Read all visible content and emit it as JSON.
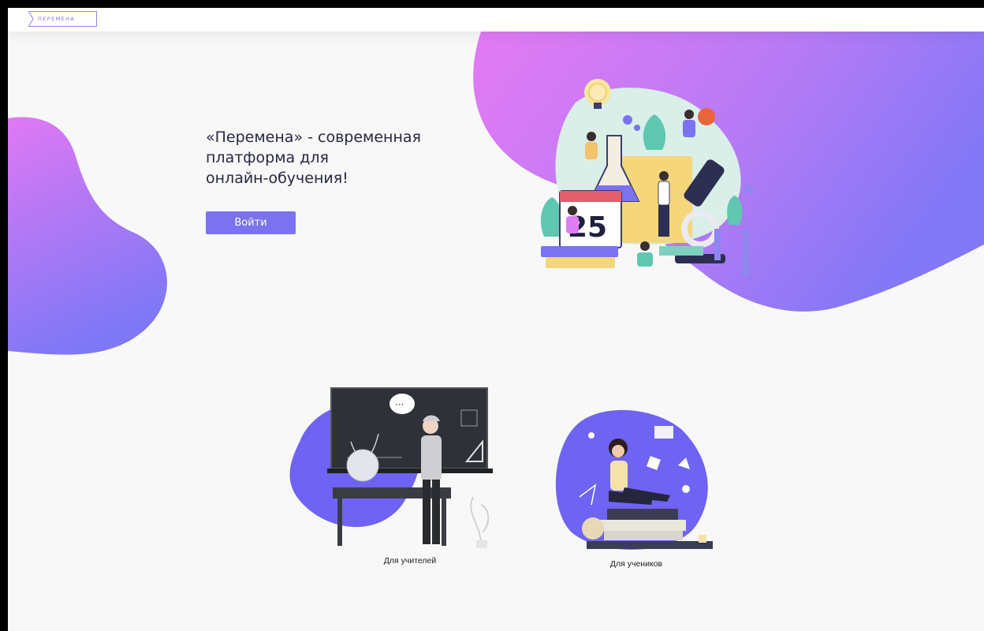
{
  "header": {
    "logo_text": "ПЕРЕМЕНА"
  },
  "hero": {
    "title_lines": [
      "«Перемена» - современная",
      "платформа для",
      "онлайн-обучения!"
    ],
    "login_label": "Войти",
    "calendar_number": "25"
  },
  "cards": {
    "teachers_label": "Для учителей",
    "students_label": "Для учеников"
  },
  "colors": {
    "accent": "#7b72f2",
    "blob_pink": "#e07cf4",
    "blob_violet": "#8a76f5",
    "text": "#262840"
  }
}
